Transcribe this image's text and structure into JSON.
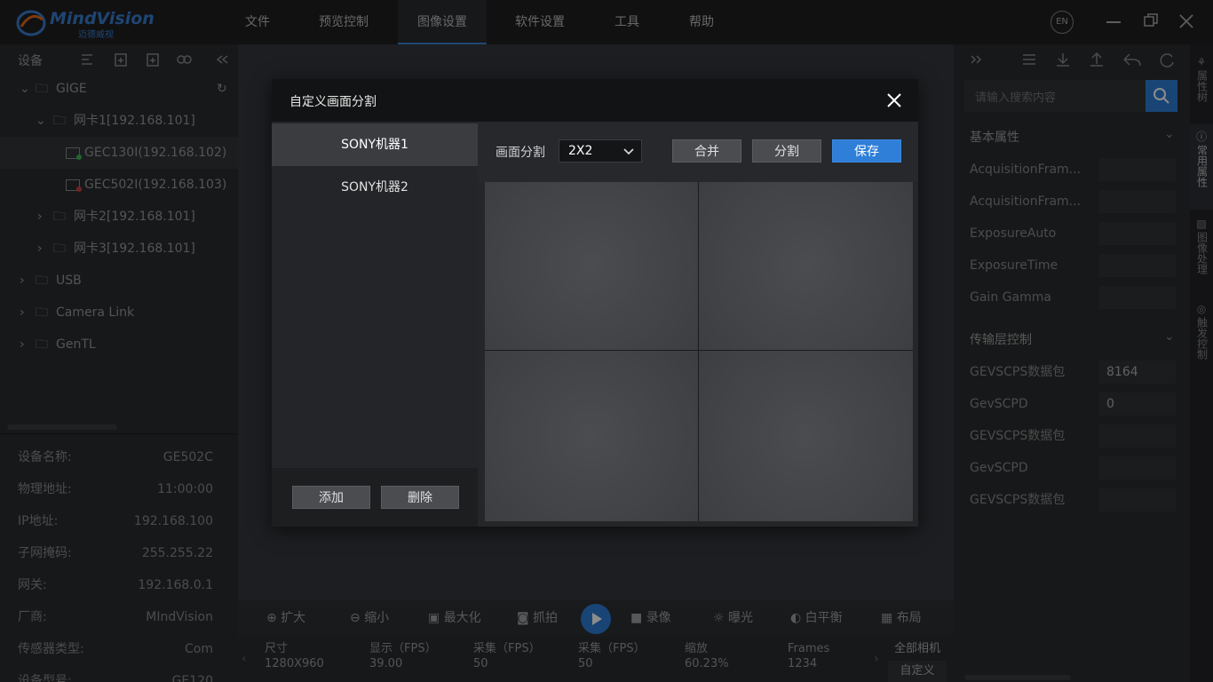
{
  "app": {
    "logo_text": "MindVision",
    "logo_sub": "迈德威视"
  },
  "menu": [
    "文件",
    "预览控制",
    "图像设置",
    "软件设置",
    "工具",
    "帮助"
  ],
  "lang": "EN",
  "left": {
    "devices_label": "设备",
    "tree": [
      {
        "label": "GIGE"
      },
      {
        "label": "网卡1[192.168.101]"
      },
      {
        "label": "GEC130I(192.168.102)"
      },
      {
        "label": "GEC502I(192.168.103)"
      },
      {
        "label": "网卡2[192.168.101]"
      },
      {
        "label": "网卡3[192.168.101]"
      },
      {
        "label": "USB"
      },
      {
        "label": "Camera Link"
      },
      {
        "label": "GenTL"
      }
    ],
    "props": [
      {
        "k": "设备名称:",
        "v": "GE502C"
      },
      {
        "k": "物理地址:",
        "v": "11:00:00"
      },
      {
        "k": "IP地址:",
        "v": "192.168.100"
      },
      {
        "k": "子网掩码:",
        "v": "255.255.22"
      },
      {
        "k": "网关:",
        "v": "192.168.0.1"
      },
      {
        "k": "厂商:",
        "v": "MIndVision"
      },
      {
        "k": "传感器类型:",
        "v": "Com"
      },
      {
        "k": "设备型号:",
        "v": "GE120"
      }
    ]
  },
  "bottom": {
    "tools": [
      "扩大",
      "缩小",
      "最大化",
      "抓拍",
      "录像",
      "曝光",
      "白平衡",
      "布局"
    ],
    "stats": [
      {
        "label": "尺寸",
        "value": "1280X960"
      },
      {
        "label": "显示（FPS）",
        "value": "39.00"
      },
      {
        "label": "采集（FPS）",
        "value": "50"
      },
      {
        "label": "采集（FPS）",
        "value": "50"
      },
      {
        "label": "缩放",
        "value": "60.23%"
      },
      {
        "label": "Frames",
        "value": "1234"
      }
    ],
    "all_cams": "全部相机",
    "custom": "自定义"
  },
  "right": {
    "search_placeholder": "请输入搜索内容",
    "section1": "基本属性",
    "basic": [
      "AcquisitionFram...",
      "AcquisitionFram...",
      "ExposureAuto",
      "ExposureTime",
      "Gain Gamma"
    ],
    "section2": "传输层控制",
    "transport": [
      {
        "k": "GEVSCPS数据包",
        "v": "8164"
      },
      {
        "k": "GevSCPD",
        "v": "0"
      },
      {
        "k": "GEVSCPS数据包",
        "v": ""
      },
      {
        "k": "GevSCPD",
        "v": ""
      },
      {
        "k": "GEVSCPS数据包",
        "v": ""
      }
    ],
    "rail": [
      "属性树",
      "常用属性",
      "图像处理",
      "触发控制"
    ]
  },
  "dialog": {
    "title": "自定义画面分割",
    "items": [
      "SONY机器1",
      "SONY机器2"
    ],
    "add": "添加",
    "delete": "删除",
    "split_label": "画面分割",
    "split_value": "2X2",
    "merge": "合并",
    "split": "分割",
    "save": "保存"
  },
  "colors": {
    "accent": "#2f7fd8",
    "selected_item": "#3a3c40"
  }
}
